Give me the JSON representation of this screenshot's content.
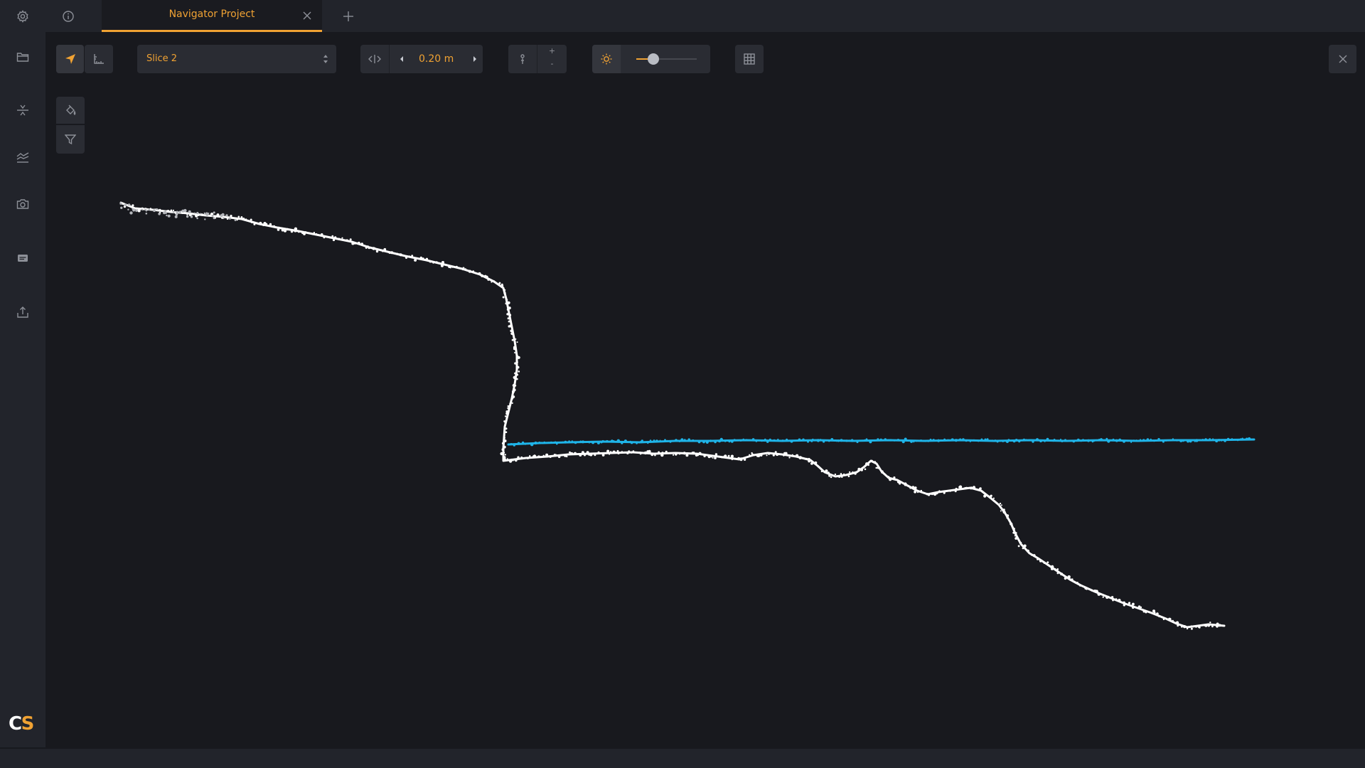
{
  "window": {
    "tab_title": "Navigator Project"
  },
  "topbar": {
    "icons": [
      "gear-icon",
      "info-icon",
      "close-icon",
      "plus-icon"
    ]
  },
  "rail": {
    "items": [
      "folder-icon",
      "compress-icon",
      "surface-icon",
      "camera-icon",
      "card-icon",
      "export-icon"
    ],
    "logo_c": "C",
    "logo_s": "S"
  },
  "toolbar": {
    "slice_select": "Slice 2",
    "step_value": "0.20 m",
    "zoom_in": "+",
    "zoom_out": "-",
    "brightness_level": 0.28
  },
  "colors": {
    "accent": "#f0a233",
    "water": "#1fb4e8",
    "profile": "#ffffff"
  },
  "chart_data": {
    "type": "scatter",
    "series": [
      {
        "color": "#ffffff",
        "description": "profile"
      },
      {
        "color": "#1fb4e8",
        "description": "water"
      }
    ]
  }
}
